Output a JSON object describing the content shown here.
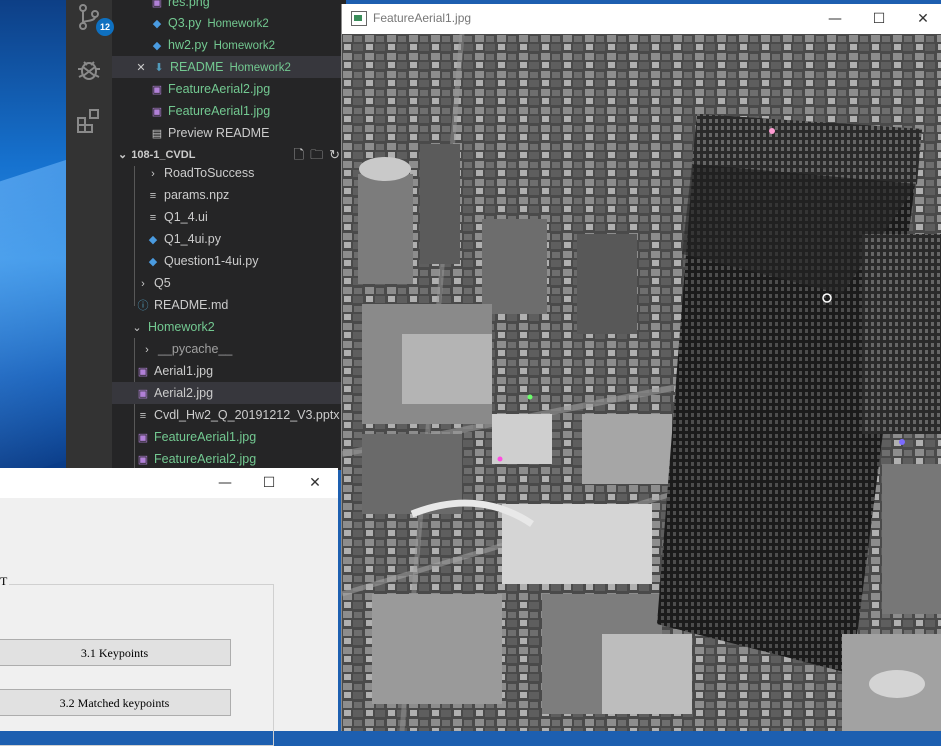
{
  "vscode": {
    "activity": {
      "scm_badge": "12"
    },
    "explorer": {
      "open_editors": [
        {
          "label": "res.png",
          "hint": "",
          "kind": "img",
          "color": "green"
        },
        {
          "label": "Q3.py",
          "hint": "Homework2",
          "kind": "py",
          "color": "green"
        },
        {
          "label": "hw2.py",
          "hint": "Homework2",
          "kind": "py",
          "color": "green"
        },
        {
          "label": "README",
          "hint": "Homework2",
          "kind": "md",
          "color": "green"
        },
        {
          "label": "FeatureAerial2.jpg",
          "hint": "",
          "kind": "img",
          "color": "green"
        },
        {
          "label": "FeatureAerial1.jpg",
          "hint": "",
          "kind": "img",
          "color": "green"
        },
        {
          "label": "Preview README",
          "hint": "",
          "kind": "preview",
          "color": "default"
        }
      ],
      "workspace_title": "108-1_CVDL",
      "tree": [
        {
          "label": "RoadToSuccess",
          "kind": "folder",
          "color": "default"
        },
        {
          "label": "params.npz",
          "kind": "file",
          "color": "default"
        },
        {
          "label": "Q1_4.ui",
          "kind": "file",
          "color": "default"
        },
        {
          "label": "Q1_4ui.py",
          "kind": "py",
          "color": "default"
        },
        {
          "label": "Question1-4ui.py",
          "kind": "py",
          "color": "default"
        },
        {
          "label": "Q5",
          "kind": "folder",
          "color": "default"
        },
        {
          "label": "README.md",
          "kind": "info",
          "color": "default"
        },
        {
          "label": "Homework2",
          "kind": "folder-open",
          "color": "green"
        },
        {
          "label": "__pycache__",
          "kind": "folder",
          "color": "default"
        },
        {
          "label": "Aerial1.jpg",
          "kind": "img",
          "color": "default"
        },
        {
          "label": "Aerial2.jpg",
          "kind": "img",
          "color": "default"
        },
        {
          "label": "Cvdl_Hw2_Q_20191212_V3.pptx",
          "kind": "file",
          "color": "default"
        },
        {
          "label": "FeatureAerial1.jpg",
          "kind": "img",
          "color": "green"
        },
        {
          "label": "FeatureAerial2.jpg",
          "kind": "img",
          "color": "green"
        }
      ]
    }
  },
  "dialog": {
    "group_title": "T",
    "btn_keypoints": "3.1 Keypoints",
    "btn_matched": "3.2 Matched keypoints",
    "ctl_min": "—",
    "ctl_max": "☐",
    "ctl_close": "✕"
  },
  "viewer": {
    "title": "FeatureAerial1.jpg",
    "ctl_min": "—",
    "ctl_max": "☐",
    "ctl_close": "✕"
  },
  "colors": {
    "vscode_green": "#73c991",
    "badge_blue": "#0e70c0",
    "sidebar_bg": "#252526"
  }
}
